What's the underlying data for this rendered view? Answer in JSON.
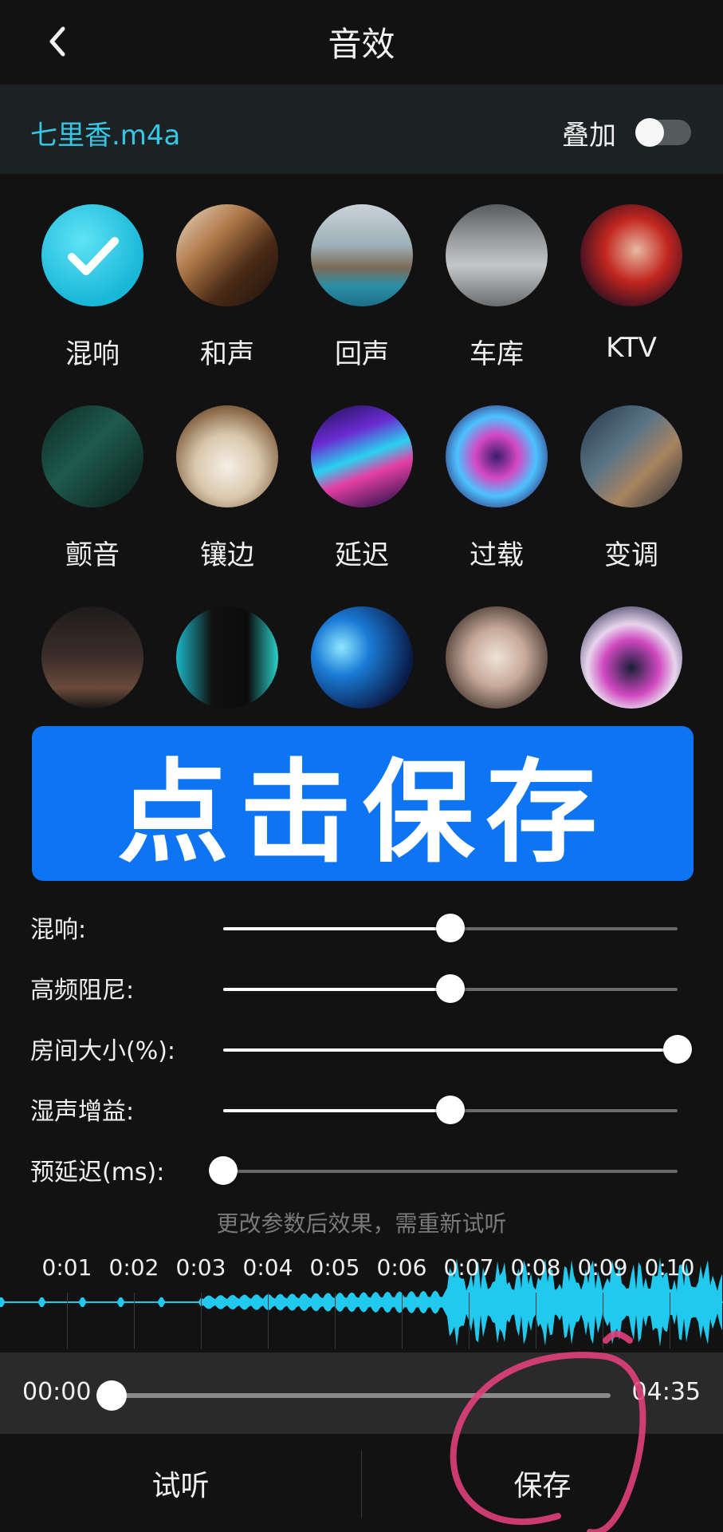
{
  "header": {
    "title": "音效"
  },
  "file": {
    "name": "七里香.m4a",
    "overlay_label": "叠加",
    "overlay_on": false
  },
  "effects": [
    {
      "label": "混响",
      "selected": true
    },
    {
      "label": "和声"
    },
    {
      "label": "回声"
    },
    {
      "label": "车库"
    },
    {
      "label": "KTV"
    },
    {
      "label": "颤音"
    },
    {
      "label": "镶边"
    },
    {
      "label": "延迟"
    },
    {
      "label": "过载"
    },
    {
      "label": "变调"
    },
    {
      "label": ""
    },
    {
      "label": ""
    },
    {
      "label": ""
    },
    {
      "label": ""
    },
    {
      "label": ""
    }
  ],
  "banner": {
    "text": "点击保存"
  },
  "params": [
    {
      "label": "混响:",
      "value_pct": 50
    },
    {
      "label": "高频阻尼:",
      "value_pct": 50
    },
    {
      "label": "房间大小(%):",
      "value_pct": 100
    },
    {
      "label": "湿声增益:",
      "value_pct": 50
    },
    {
      "label": "预延迟(ms):",
      "value_pct": 0
    }
  ],
  "hint": "更改参数后效果，需重新试听",
  "timeline": {
    "ticks": [
      "0:01",
      "0:02",
      "0:03",
      "0:04",
      "0:05",
      "0:06",
      "0:07",
      "0:08",
      "0:09",
      "0:10"
    ]
  },
  "player": {
    "current": "00:00",
    "total": "04:35",
    "progress": 0
  },
  "buttons": {
    "preview": "试听",
    "save": "保存"
  },
  "colors": {
    "accent": "#37c6e6",
    "banner": "#0d74f4",
    "waveform": "#22c9ef",
    "annotation": "#e0407a"
  }
}
